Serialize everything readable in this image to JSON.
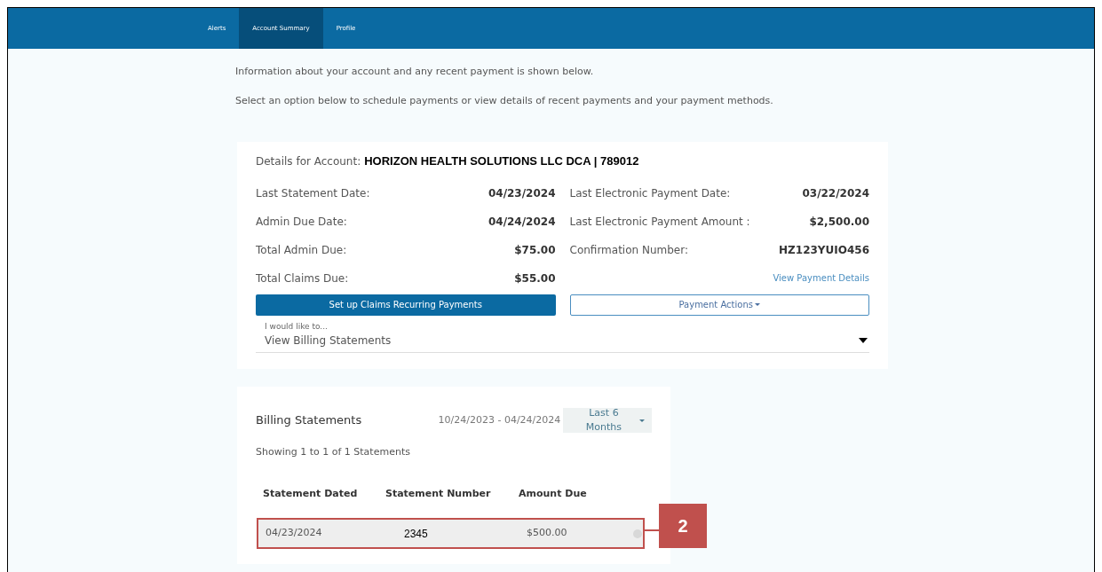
{
  "nav": {
    "tabs": [
      {
        "label": "Alerts",
        "selected": false
      },
      {
        "label": "Account Summary",
        "selected": true
      },
      {
        "label": "Profile",
        "selected": false
      }
    ]
  },
  "intro": [
    "Information about your account and any recent payment is shown below.",
    "Select an option below to schedule payments or view details of recent payments and your payment methods."
  ],
  "account": {
    "label": "Details for Account:",
    "name": "HORIZON HEALTH SOLUTIONS LLC DCA | 789012",
    "left": [
      {
        "label": "Last Statement Date:",
        "value": "04/23/2024"
      },
      {
        "label": "Admin Due Date:",
        "value": "04/24/2024"
      },
      {
        "label": "Total Admin Due:",
        "value": "$75.00"
      },
      {
        "label": "Total Claims Due:",
        "value": "$55.00"
      }
    ],
    "right": [
      {
        "label": "Last Electronic Payment Date:",
        "value": "03/22/2024"
      },
      {
        "label": "Last Electronic Payment Amount :",
        "value": "$2,500.00"
      },
      {
        "label": "Confirmation Number:",
        "value": "HZ123YUIO456"
      }
    ],
    "details_link": "View Payment Details",
    "primary_button": "Set up Claims Recurring Payments",
    "actions_button": "Payment Actions",
    "select": {
      "label": "I would like to...",
      "value": "View Billing Statements"
    }
  },
  "billing": {
    "title": "Billing Statements",
    "range": "10/24/2023 - 04/24/2024",
    "period": "Last 6 Months",
    "showing": "Showing 1 to 1 of 1 Statements",
    "columns": [
      "Statement Dated",
      "Statement Number",
      "Amount Due"
    ],
    "rows": [
      [
        "04/23/2024",
        "2345",
        "$500.00"
      ]
    ]
  },
  "callout": "2"
}
